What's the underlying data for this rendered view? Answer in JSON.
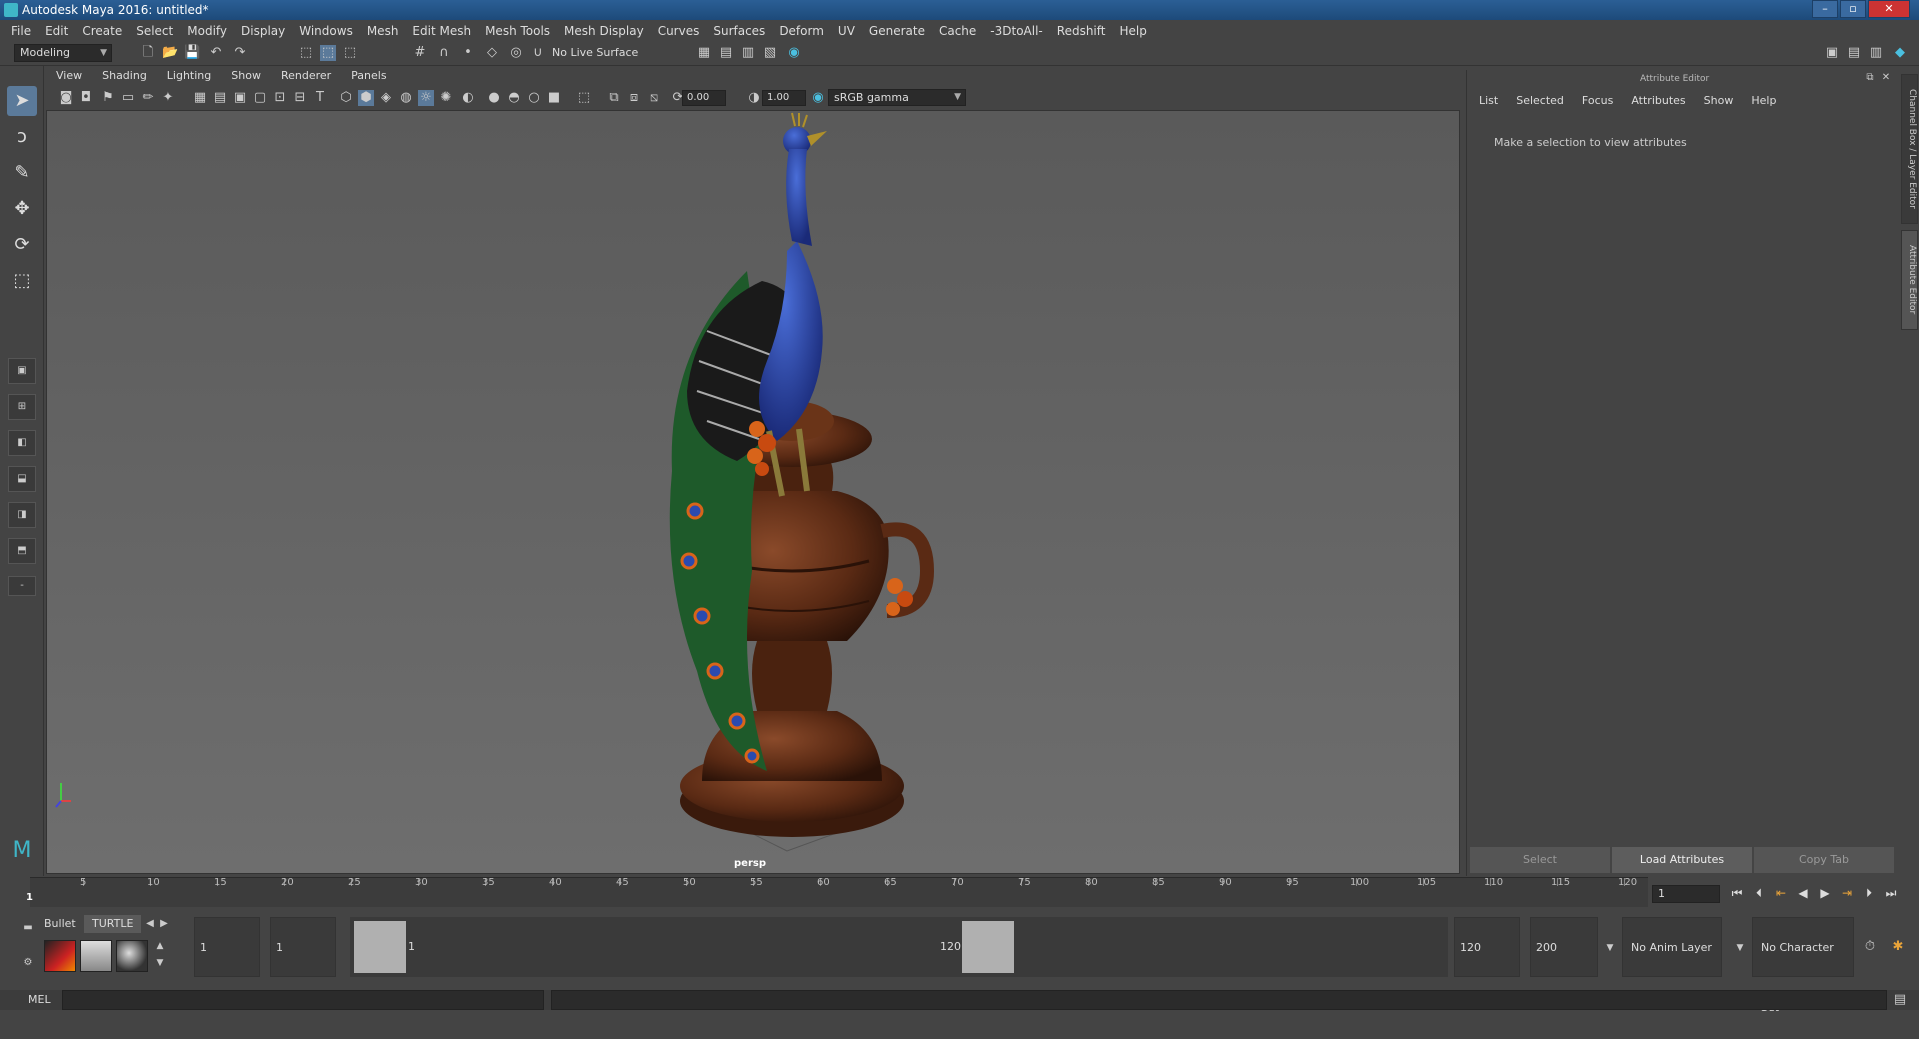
{
  "window": {
    "title": "Autodesk Maya 2016: untitled*",
    "controls": [
      "–",
      "▫",
      "✕"
    ]
  },
  "menubar": [
    "File",
    "Edit",
    "Create",
    "Select",
    "Modify",
    "Display",
    "Windows",
    "Mesh",
    "Edit Mesh",
    "Mesh Tools",
    "Mesh Display",
    "Curves",
    "Surfaces",
    "Deform",
    "UV",
    "Generate",
    "Cache",
    "-3DtoAll-",
    "Redshift",
    "Help"
  ],
  "toolbar": {
    "mode": "Modeling",
    "live_surface": "No Live Surface"
  },
  "panel_menu": [
    "View",
    "Shading",
    "Lighting",
    "Show",
    "Renderer",
    "Panels"
  ],
  "viewport": {
    "exposure": "0.00",
    "gamma": "1.00",
    "color_space": "sRGB gamma",
    "camera_label": "persp"
  },
  "attribute_editor": {
    "title": "Attribute Editor",
    "menu": [
      "List",
      "Selected",
      "Focus",
      "Attributes",
      "Show",
      "Help"
    ],
    "message": "Make a selection to view attributes",
    "buttons": {
      "select": "Select",
      "load": "Load Attributes",
      "copy": "Copy Tab"
    }
  },
  "side_tabs": {
    "channel_box": "Channel Box / Layer Editor",
    "attribute_editor": "Attribute Editor"
  },
  "timeline": {
    "ticks": [
      5,
      10,
      15,
      20,
      25,
      30,
      35,
      40,
      45,
      50,
      55,
      60,
      65,
      70,
      75,
      80,
      85,
      90,
      95,
      100,
      105,
      110,
      115,
      120
    ],
    "current_frame_label": "1",
    "current_frame": "1"
  },
  "shelf": {
    "tabs": [
      "Bullet",
      "TURTLE"
    ]
  },
  "range": {
    "start_time": "1",
    "playback_start": "1",
    "slider_start": "1",
    "slider_end": "120",
    "playback_end": "120",
    "end_time": "200",
    "anim_layer": "No Anim Layer",
    "character_set": "No Character Set"
  },
  "command_line": {
    "label": "MEL"
  },
  "colors": {
    "title_bar": "#2b5f95",
    "ui_bg": "#444444",
    "viewport": "#636363",
    "selected_tool": "#5b7a9a"
  }
}
